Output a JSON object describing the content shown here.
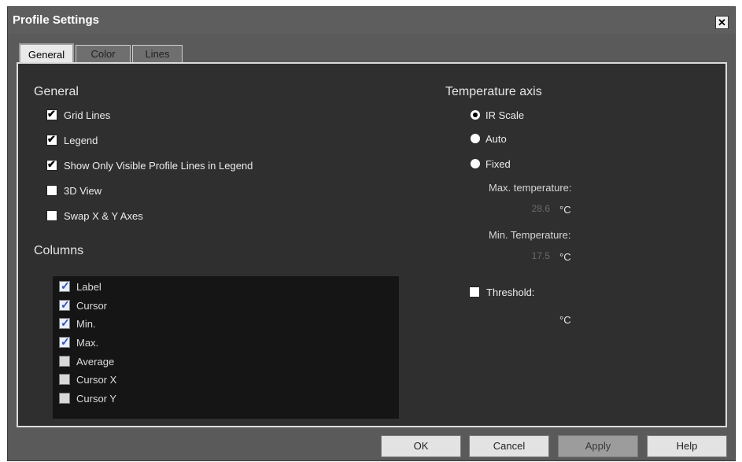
{
  "window": {
    "title": "Profile Settings",
    "close_glyph": "✕"
  },
  "tabs": [
    {
      "label": "General",
      "active": true
    },
    {
      "label": "Color",
      "active": false
    },
    {
      "label": "Lines",
      "active": false
    }
  ],
  "general": {
    "heading": "General",
    "options": [
      {
        "label": "Grid Lines",
        "checked": true
      },
      {
        "label": "Legend",
        "checked": true
      },
      {
        "label": "Show Only Visible Profile Lines in Legend",
        "checked": true
      },
      {
        "label": "3D View",
        "checked": false
      },
      {
        "label": "Swap X & Y Axes",
        "checked": false
      }
    ]
  },
  "columns": {
    "heading": "Columns",
    "items": [
      {
        "label": "Label",
        "checked": true
      },
      {
        "label": "Cursor",
        "checked": true
      },
      {
        "label": "Min.",
        "checked": true
      },
      {
        "label": "Max.",
        "checked": true
      },
      {
        "label": "Average",
        "checked": false
      },
      {
        "label": "Cursor X",
        "checked": false
      },
      {
        "label": "Cursor Y",
        "checked": false
      }
    ]
  },
  "temperature_axis": {
    "heading": "Temperature axis",
    "modes": [
      {
        "label": "IR Scale",
        "selected": true
      },
      {
        "label": "Auto",
        "selected": false
      },
      {
        "label": "Fixed",
        "selected": false
      }
    ],
    "max_label": "Max. temperature:",
    "max_value": "28.6",
    "min_label": "Min. Temperature:",
    "min_value": "17.5",
    "unit": "°C",
    "threshold_label": "Threshold:",
    "threshold_checked": false
  },
  "buttons": {
    "ok": "OK",
    "cancel": "Cancel",
    "apply": "Apply",
    "help": "Help"
  }
}
